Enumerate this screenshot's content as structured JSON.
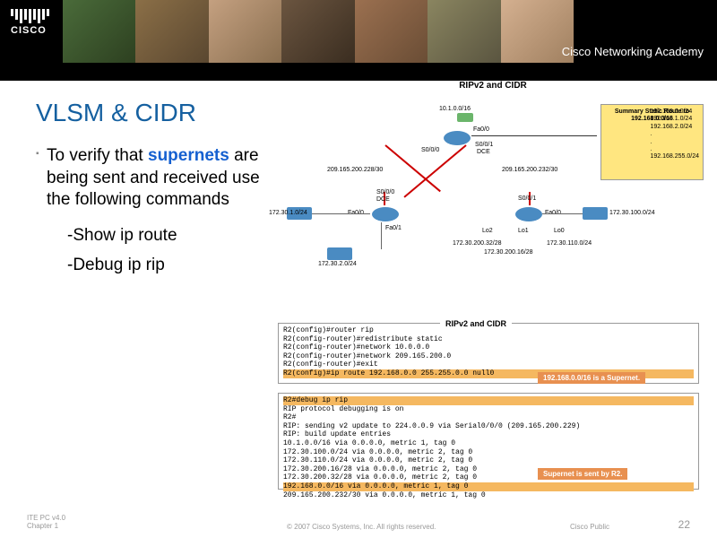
{
  "header": {
    "brand": "CISCO",
    "academy": "Cisco Networking Academy"
  },
  "title": "VLSM & CIDR",
  "body": {
    "main_text_pre": "To verify that ",
    "main_text_highlight": "supernets",
    "main_text_post": " are being sent and received use the following commands",
    "cmd1": "-Show ip route",
    "cmd2": "-Debug ip rip"
  },
  "diagram": {
    "title": "RIPv2 and CIDR",
    "labels": {
      "r2_top": "10.1.0.0/16",
      "fa00": "Fa0/0",
      "s000": "S0/0/0",
      "s001": "S0/0/1",
      "dce": "DCE",
      "left_link": "209.165.200.228/30",
      "right_link": "209.165.200.232/30",
      "sw_tl": "172.30.1.0/24",
      "sw_bl": "172.30.2.0/24",
      "sw_tr": "172.30.100.0/24",
      "lo0": "Lo0",
      "lo1": "Lo1",
      "lo2": "Lo2",
      "fa01": "Fa0/1",
      "lo0_net": "172.30.110.0/24",
      "lo1_net": "172.30.200.16/28",
      "lo2_net": "172.30.200.32/28"
    },
    "summary": {
      "title": "Summary Static Route to 192.168.0.0/16",
      "n1": "192.168.0.0/24",
      "n2": "192.168.1.0/24",
      "n3": "192.168.2.0/24",
      "dots": ".",
      "nlast": "192.168.255.0/24"
    }
  },
  "cli1": {
    "title": "RIPv2 and CIDR",
    "l1": "R2(config)#router rip",
    "l2": "R2(config-router)#redistribute static",
    "l3": "R2(config-router)#network 10.0.0.0",
    "l4": "R2(config-router)#network 209.165.200.0",
    "l5": "R2(config-router)#exit",
    "l6": "R2(config)#ip route 192.168.0.0 255.255.0.0 null0"
  },
  "note1": "192.168.0.0/16 is a Supernet.",
  "cli2": {
    "l1": "R2#debug ip rip",
    "l2": "RIP protocol debugging is on",
    "l3": "R2#",
    "l4": "RIP: sending v2 update to 224.0.0.9 via Serial0/0/0 (209.165.200.229)",
    "l5": "RIP: build update entries",
    "l6": "      10.1.0.0/16 via 0.0.0.0, metric 1, tag 0",
    "l7": "      172.30.100.0/24 via 0.0.0.0, metric 2, tag 0",
    "l8": "      172.30.110.0/24 via 0.0.0.0, metric 2, tag 0",
    "l9": "      172.30.200.16/28 via 0.0.0.0, metric 2, tag 0",
    "l10": "      172.30.200.32/28 via 0.0.0.0, metric 2, tag 0",
    "l11": "      192.168.0.0/16 via 0.0.0.0, metric 1, tag 0",
    "l12": "      209.165.200.232/30 via 0.0.0.0, metric 1, tag 0"
  },
  "note2": "Supernet is sent by R2.",
  "footer": {
    "left1": "ITE PC v4.0",
    "left2": "Chapter 1",
    "center": "© 2007 Cisco Systems, Inc. All rights reserved.",
    "right1": "Cisco Public",
    "page": "22"
  }
}
